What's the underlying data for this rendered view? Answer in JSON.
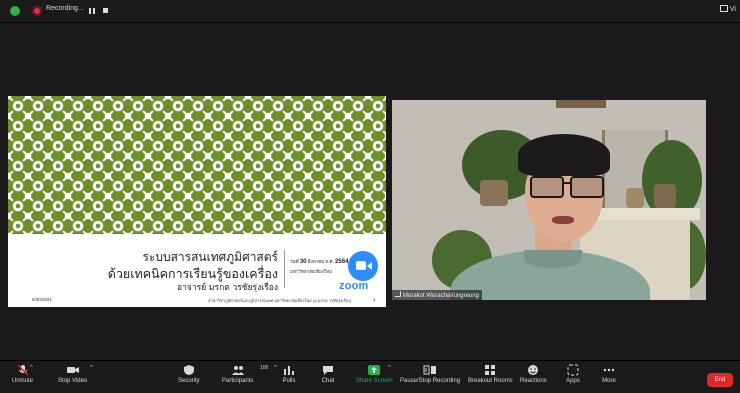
{
  "top_bar": {
    "recording_label": "Recording...",
    "view_label": "Vi"
  },
  "slide": {
    "title_line1": "ระบบสารสนเทศภูมิศาสตร์",
    "title_line2": "ด้วยเทคนิคการเรียนรู้ของเครื่อง",
    "author": "อาจารย์ มรกต วรชัยรุ่งเรือง",
    "date_info_prefix": "วันที่",
    "date_info_number": "30",
    "date_info_rest": "สิงหาคม พ.ศ.",
    "date_info_year": "2564",
    "university": "มหาวิทยาลัยเชียงใหม่",
    "zoom_word": "zoom",
    "footer_date": "8/30/2021",
    "footer_text": "สาขาวิชาภูมิศาสตร์และภูมิสารสนเทศ มหาวิทยาลัยเชียงใหม่ (ม.มรกต วรชัยรุ่งเรือง)",
    "footer_page": "1"
  },
  "video": {
    "participant_name": "Morakot Worachairungreung"
  },
  "toolbar": {
    "items": [
      {
        "label": "Unmute",
        "icon": "microphone-muted-icon"
      },
      {
        "label": "Stop Video",
        "icon": "video-camera-icon"
      },
      {
        "label": "Security",
        "icon": "shield-icon"
      },
      {
        "label": "Participants",
        "icon": "participants-icon",
        "count": "100"
      },
      {
        "label": "Polls",
        "icon": "polls-icon"
      },
      {
        "label": "Chat",
        "icon": "chat-icon"
      },
      {
        "label": "Share Screen",
        "icon": "share-screen-icon"
      },
      {
        "label": "Pause/Stop Recording",
        "icon": "pause-stop-recording-icon"
      },
      {
        "label": "Breakout Rooms",
        "icon": "breakout-rooms-icon"
      },
      {
        "label": "Reactions",
        "icon": "reactions-icon"
      },
      {
        "label": "Apps",
        "icon": "apps-icon"
      },
      {
        "label": "More",
        "icon": "more-icon"
      }
    ],
    "end_label": "End"
  },
  "colors": {
    "zoom_blue": "#2d8cff",
    "share_green": "#22b14c",
    "end_red": "#e02828",
    "pattern_green": "#6f8f2a"
  }
}
